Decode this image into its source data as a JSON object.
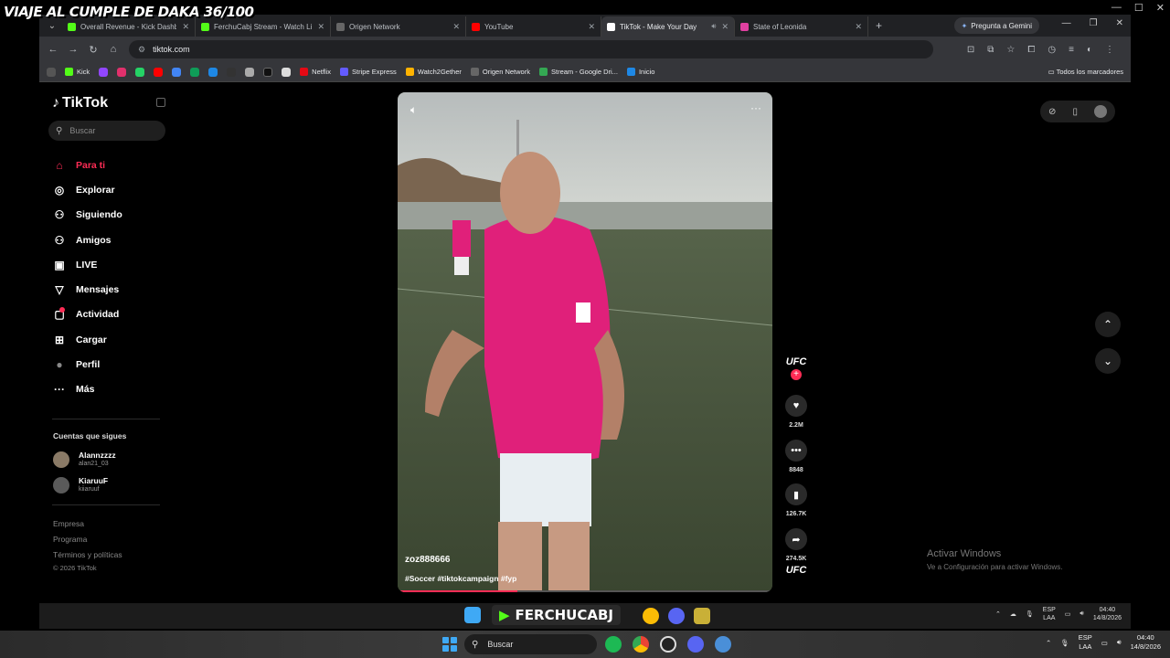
{
  "overlay": {
    "stream_title": "VIAJE AL CUMPLE DE DAKA 36/100"
  },
  "browser": {
    "tabs": [
      {
        "title": "Overall Revenue - Kick Dashbo...",
        "color": "#53fc18"
      },
      {
        "title": "FerchuCabj Stream - Watch Live",
        "color": "#53fc18"
      },
      {
        "title": "Origen Network",
        "color": "#888888"
      },
      {
        "title": "YouTube",
        "color": "#ff0000"
      },
      {
        "title": "TikTok - Make Your Day",
        "color": "#ffffff",
        "active": true
      },
      {
        "title": "State of Leonida",
        "color": "#e040a0"
      }
    ],
    "gemini_label": "Pregunta a Gemini",
    "url": "tiktok.com",
    "bookmarks": [
      "Kick",
      "Netflix",
      "Stripe Express",
      "Watch2Gether",
      "Origen Network",
      "Stream - Google Dri...",
      "Inicio"
    ],
    "bookmarks_all": "Todos los marcadores"
  },
  "tiktok": {
    "logo": "TikTok",
    "search_placeholder": "Buscar",
    "nav": [
      {
        "label": "Para ti",
        "icon": "home-icon",
        "glyph": "⌂"
      },
      {
        "label": "Explorar",
        "icon": "compass-icon",
        "glyph": "◎"
      },
      {
        "label": "Siguiendo",
        "icon": "following-icon",
        "glyph": "⚇"
      },
      {
        "label": "Amigos",
        "icon": "friends-icon",
        "glyph": "⚇"
      },
      {
        "label": "LIVE",
        "icon": "live-icon",
        "glyph": "▣"
      },
      {
        "label": "Mensajes",
        "icon": "messages-icon",
        "glyph": "▽"
      },
      {
        "label": "Actividad",
        "icon": "activity-icon",
        "glyph": "▢"
      },
      {
        "label": "Cargar",
        "icon": "upload-icon",
        "glyph": "⊞"
      },
      {
        "label": "Perfil",
        "icon": "profile-icon",
        "glyph": "●"
      },
      {
        "label": "Más",
        "icon": "more-icon",
        "glyph": "···"
      }
    ],
    "following_title": "Cuentas que sigues",
    "accounts": [
      {
        "name": "Alannzzzz",
        "handle": "alan21_03"
      },
      {
        "name": "KiaruuF",
        "handle": "kiiaruuf"
      }
    ],
    "footer": [
      "Empresa",
      "Programa",
      "Términos y políticas",
      "© 2026 TikTok"
    ],
    "video": {
      "username": "zoz888666",
      "tags": "#Soccer #tiktokcampaign  #fyp",
      "progress": 0.32
    },
    "actions": {
      "brand": "UFC",
      "likes": "2.2M",
      "comments": "8848",
      "saves": "126.7K",
      "shares": "274.5K"
    },
    "activate_windows": {
      "line1": "Activar Windows",
      "line2": "Ve a Configuración para activar Windows."
    }
  },
  "inner_taskbar": {
    "overlay_name": "FERCHUCABJ",
    "lang": "ESP",
    "layout": "LAA",
    "time": "04:40",
    "date": "14/8/2026"
  },
  "taskbar": {
    "search_placeholder": "Buscar",
    "lang": "ESP",
    "layout": "LAA",
    "time": "04:40",
    "date": "14/8/2026"
  }
}
